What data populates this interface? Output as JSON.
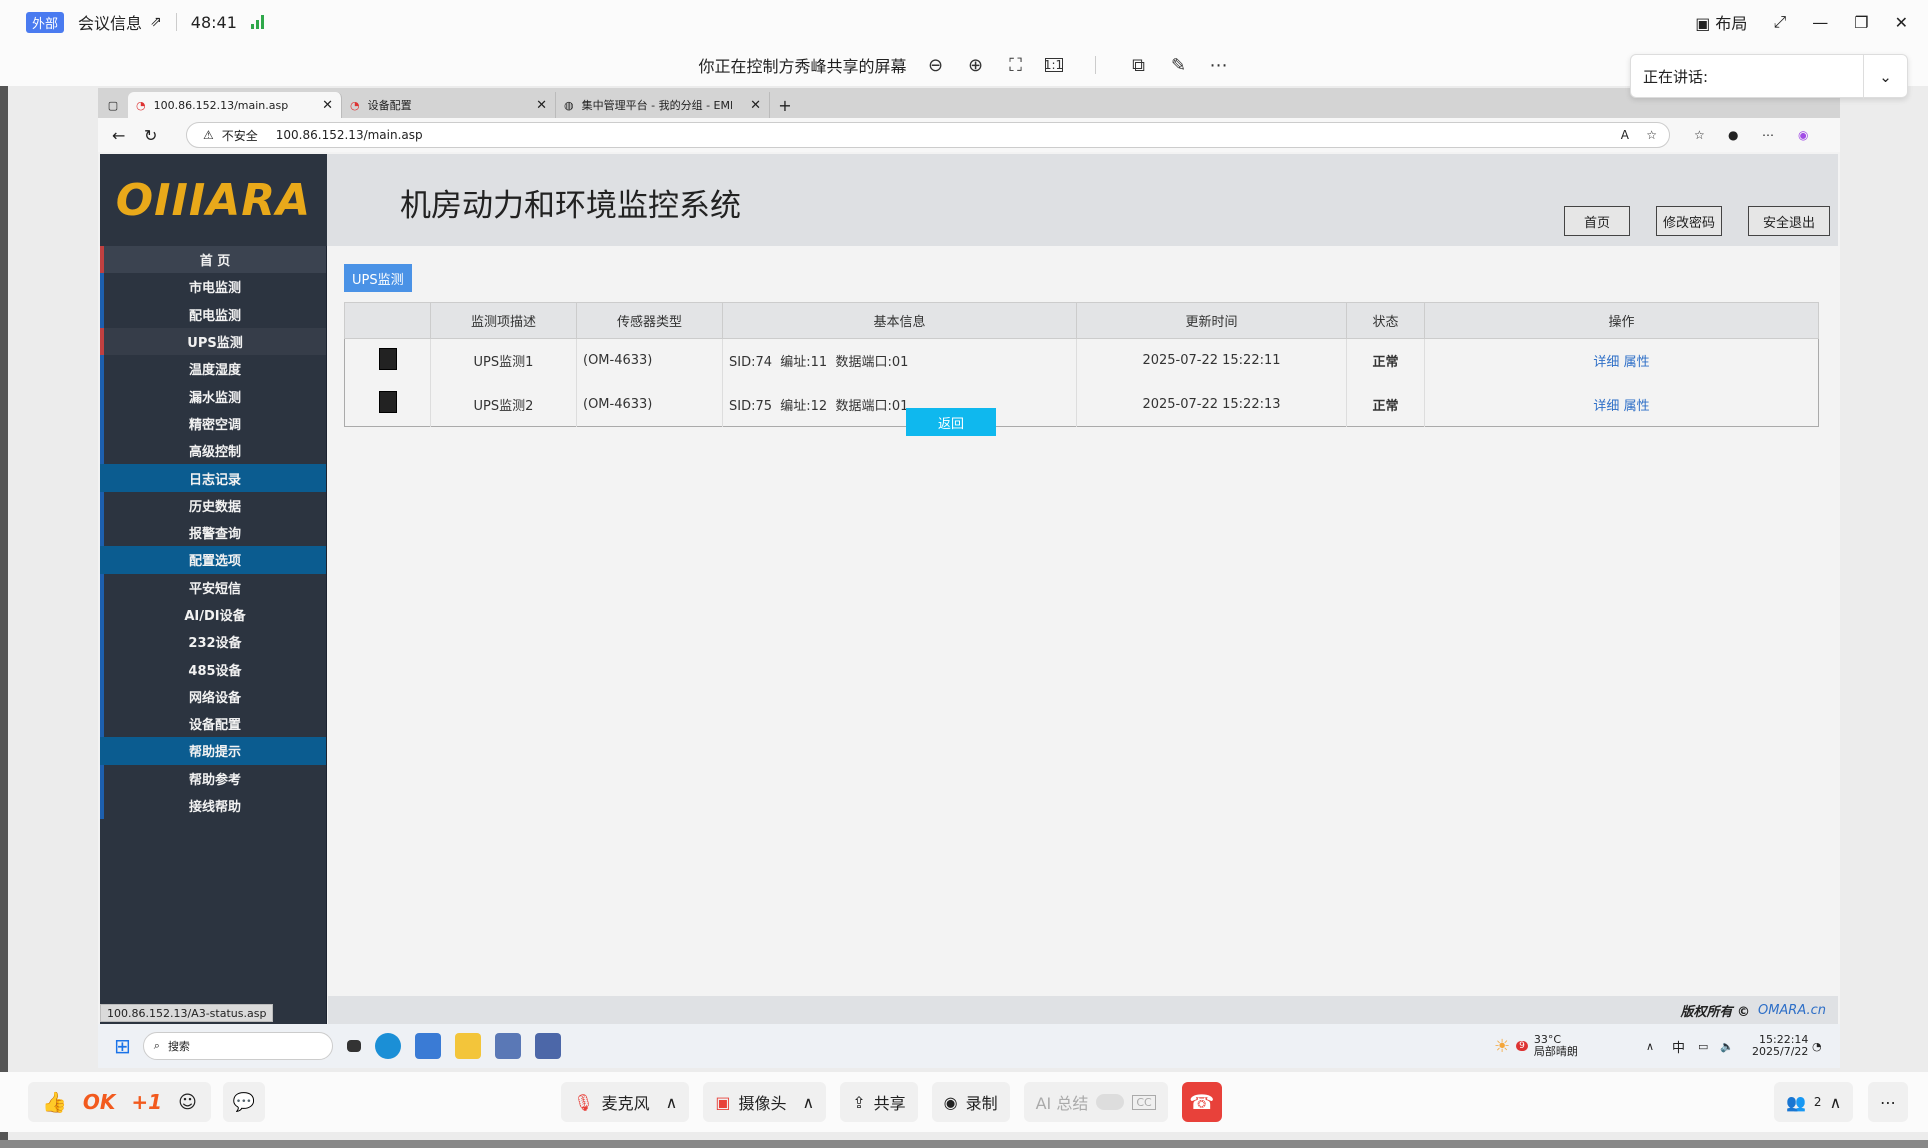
{
  "meeting": {
    "external_badge": "外部",
    "info_label": "会议信息",
    "timer": "48:41",
    "layout_label": "布局",
    "share_notice": "你正在控制方秀峰共享的屏幕",
    "speaking_label": "正在讲话:"
  },
  "browser": {
    "tabs": [
      {
        "label": "100.86.152.13/main.asp"
      },
      {
        "label": "设备配置"
      },
      {
        "label": "集中管理平台 - 我的分组 - EMDF"
      }
    ],
    "insecure_label": "不安全",
    "url": "100.86.152.13/main.asp"
  },
  "site": {
    "logo": "OIIIARA",
    "title": "机房动力和环境监控系统",
    "header_buttons": [
      "首页",
      "修改密码",
      "安全退出"
    ],
    "sidebar": [
      {
        "label": "首 页",
        "kind": "home"
      },
      {
        "label": "市电监测",
        "kind": "item"
      },
      {
        "label": "配电监测",
        "kind": "item"
      },
      {
        "label": "UPS监测",
        "kind": "cur"
      },
      {
        "label": "温度湿度",
        "kind": "item"
      },
      {
        "label": "漏水监测",
        "kind": "item"
      },
      {
        "label": "精密空调",
        "kind": "item"
      },
      {
        "label": "高级控制",
        "kind": "item"
      },
      {
        "label": "日志记录",
        "kind": "sec"
      },
      {
        "label": "历史数据",
        "kind": "item"
      },
      {
        "label": "报警查询",
        "kind": "item"
      },
      {
        "label": "配置选项",
        "kind": "sec"
      },
      {
        "label": "平安短信",
        "kind": "item"
      },
      {
        "label": "AI/DI设备",
        "kind": "item"
      },
      {
        "label": "232设备",
        "kind": "item"
      },
      {
        "label": "485设备",
        "kind": "item"
      },
      {
        "label": "网络设备",
        "kind": "item"
      },
      {
        "label": "设备配置",
        "kind": "item"
      },
      {
        "label": "帮助提示",
        "kind": "sec"
      },
      {
        "label": "帮助参考",
        "kind": "item"
      },
      {
        "label": "接线帮助",
        "kind": "item"
      }
    ],
    "section_tag": "UPS监测",
    "table": {
      "headers": [
        "",
        "监测项描述",
        "传感器类型",
        "基本信息",
        "更新时间",
        "状态",
        "操作"
      ],
      "rows": [
        {
          "desc": "UPS监测1",
          "type": "(OM-4633)",
          "info": "SID:74  编址:11  数据端口:01",
          "time": "2025-07-22 15:22:11",
          "status": "正常",
          "detail": "详细",
          "attr": "属性"
        },
        {
          "desc": "UPS监测2",
          "type": "(OM-4633)",
          "info": "SID:75  编址:12  数据端口:01",
          "time": "2025-07-22 15:22:13",
          "status": "正常",
          "detail": "详细",
          "attr": "属性"
        }
      ]
    },
    "back_label": "返回",
    "footer_copyright": "版权所有 ©",
    "footer_link": "OMARA.cn",
    "status_url": "100.86.152.13/A3-status.asp"
  },
  "remote_taskbar": {
    "search_placeholder": "搜索",
    "weather_temp": "33°C",
    "weather_desc": "局部晴朗",
    "weather_badge": "9",
    "ime": "中",
    "time": "15:22:14",
    "date": "2025/7/22"
  },
  "toolbar": {
    "ok_label": "OK",
    "plus_one": "+1",
    "mic_label": "麦克风",
    "camera_label": "摄像头",
    "share_label": "共享",
    "record_label": "录制",
    "ai_label": "AI 总结",
    "cc_label": "CC",
    "participants_count": "2"
  }
}
